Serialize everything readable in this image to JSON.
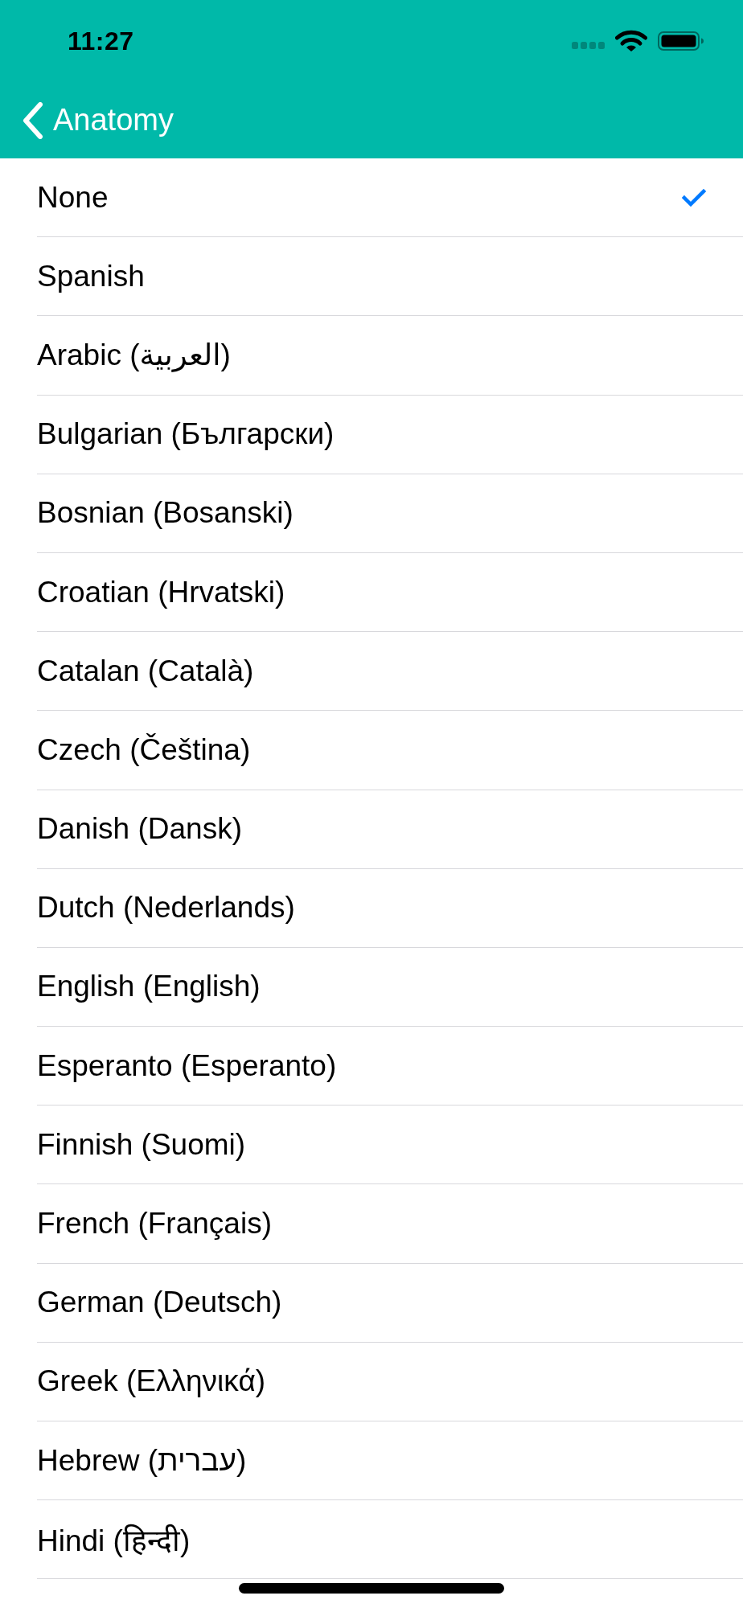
{
  "status_bar": {
    "time": "11:27"
  },
  "nav_bar": {
    "back_label": "Anatomy"
  },
  "languages": [
    {
      "label": "None",
      "selected": true
    },
    {
      "label": "Spanish",
      "selected": false
    },
    {
      "label": "Arabic (العربية)",
      "selected": false
    },
    {
      "label": "Bulgarian (Български)",
      "selected": false
    },
    {
      "label": "Bosnian (Bosanski)",
      "selected": false
    },
    {
      "label": "Croatian (Hrvatski)",
      "selected": false
    },
    {
      "label": "Catalan (Català)",
      "selected": false
    },
    {
      "label": "Czech (Čeština)",
      "selected": false
    },
    {
      "label": "Danish (Dansk)",
      "selected": false
    },
    {
      "label": "Dutch (Nederlands)",
      "selected": false
    },
    {
      "label": "English (English)",
      "selected": false
    },
    {
      "label": "Esperanto (Esperanto)",
      "selected": false
    },
    {
      "label": "Finnish (Suomi)",
      "selected": false
    },
    {
      "label": "French (Français)",
      "selected": false
    },
    {
      "label": "German (Deutsch)",
      "selected": false
    },
    {
      "label": "Greek (Ελληνικά)",
      "selected": false
    },
    {
      "label": "Hebrew (עברית)",
      "selected": false
    },
    {
      "label": "Hindi (हिन्दी)",
      "selected": false
    }
  ]
}
